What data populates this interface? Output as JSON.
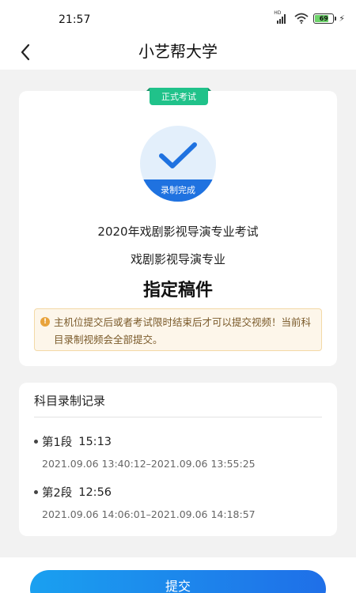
{
  "status_bar": {
    "time": "21:57",
    "signal_label": "HD",
    "battery_level": "69"
  },
  "header": {
    "title": "小艺帮大学"
  },
  "exam": {
    "tag": "正式考试",
    "status_label": "录制完成",
    "exam_name": "2020年戏剧影视导演专业考试",
    "major": "戏剧影视导演专业",
    "assignment": "指定稿件",
    "notice": "主机位提交后或者考试限时结束后才可以提交视频！当前科目录制视频会全部提交。"
  },
  "records": {
    "title": "科目录制记录",
    "segments": [
      {
        "name": "第1段",
        "duration": "15:13",
        "range": "2021.09.06 13:40:12–2021.09.06 13:55:25"
      },
      {
        "name": "第2段",
        "duration": "12:56",
        "range": "2021.09.06 14:06:01–2021.09.06 14:18:57"
      }
    ]
  },
  "submit": {
    "label": "提交"
  },
  "colors": {
    "accent_blue": "#1f72e0",
    "tag_green": "#20c28a",
    "notice_bg": "#fdf6ea"
  },
  "icons": [
    "back-icon",
    "check-icon",
    "warning-icon",
    "wifi-icon",
    "battery-icon",
    "charging-icon",
    "signal-icon"
  ]
}
